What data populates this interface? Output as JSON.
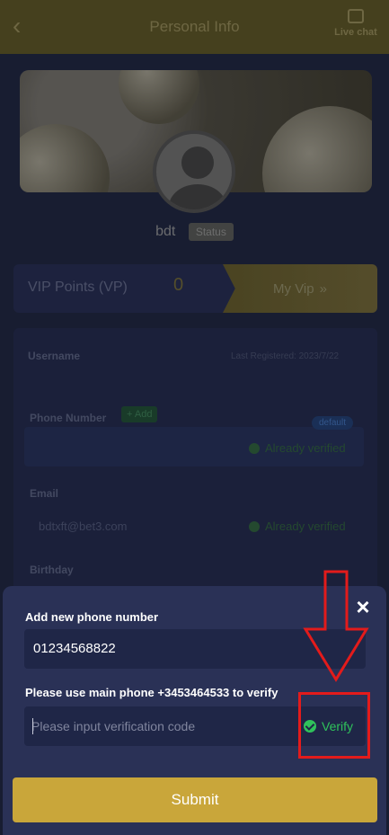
{
  "header": {
    "title": "Personal Info",
    "live_chat_label": "Live chat"
  },
  "profile": {
    "username": "bdt",
    "status_label": "Status"
  },
  "vip": {
    "label": "VIP Points (VP)",
    "value": "0",
    "button_label": "My Vip"
  },
  "info": {
    "username_label": "Username",
    "last_registered": "Last Registered: 2023/7/22",
    "phone_label": "Phone Number",
    "add_label": "Add",
    "default_label": "default",
    "phone_status": "Already verified",
    "email_label": "Email",
    "email_value": "bdtxft@bet3.com",
    "email_status": "Already verified",
    "birthday_label": "Birthday"
  },
  "modal": {
    "close_glyph": "×",
    "add_phone_label": "Add new phone number",
    "phone_value": "01234568822",
    "verify_instruction": "Please use main phone +3453464533 to verify",
    "code_placeholder": "Please input verification code",
    "verify_label": "Verify",
    "submit_label": "Submit"
  },
  "colors": {
    "accent_gold": "#c9a63a",
    "verify_green": "#2fc25b",
    "annotation_red": "#e31b1b",
    "modal_bg": "#2a3156"
  },
  "icons": [
    "back-arrow-icon",
    "live-chat-icon",
    "double-chevron-right-icon",
    "close-icon",
    "check-circle-icon",
    "verified-check-icon"
  ]
}
